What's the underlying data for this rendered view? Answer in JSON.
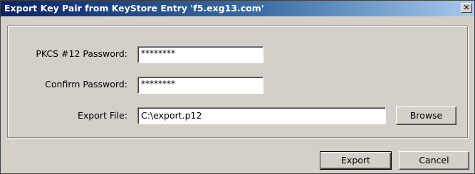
{
  "window": {
    "title": "Export Key Pair from KeyStore Entry 'f5.exg13.com'",
    "close_glyph": "✕"
  },
  "form": {
    "pkcs_label": "PKCS #12 Password:",
    "pkcs_value": "********",
    "confirm_label": "Confirm Password:",
    "confirm_value": "********",
    "export_file_label": "Export File:",
    "export_file_value": "C:\\export.p12",
    "browse_label": "Browse"
  },
  "actions": {
    "export_label": "Export",
    "cancel_label": "Cancel"
  }
}
